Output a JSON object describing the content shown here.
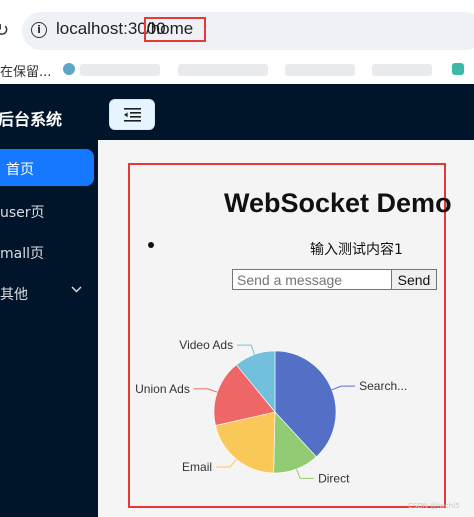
{
  "browser": {
    "url_host": "localhost:3000",
    "url_path": "/home",
    "bookmark_label": "在保留..."
  },
  "header": {
    "brand": "后台系统"
  },
  "sidebar": {
    "items": [
      {
        "label": "首页",
        "active": true
      },
      {
        "label": "user页",
        "active": false
      },
      {
        "label": "mall页",
        "active": false
      },
      {
        "label": "其他",
        "active": false,
        "has_submenu": true
      }
    ]
  },
  "main": {
    "title": "WebSocket Demo",
    "messages": [
      "输入测试内容1"
    ],
    "input": {
      "placeholder": "Send a message",
      "value": ""
    },
    "send_label": "Send"
  },
  "chart_data": {
    "type": "pie",
    "start_angle_deg": 90,
    "slices": [
      {
        "name": "Search...",
        "value": 1048,
        "color": "#5470c6"
      },
      {
        "name": "Direct",
        "value": 335,
        "color": "#91cc75"
      },
      {
        "name": "Email",
        "value": 580,
        "color": "#fac858"
      },
      {
        "name": "Union Ads",
        "value": 484,
        "color": "#ee6666"
      },
      {
        "name": "Video Ads",
        "value": 300,
        "color": "#73c0de"
      }
    ]
  },
  "watermark": "CSDN @lwchi5"
}
